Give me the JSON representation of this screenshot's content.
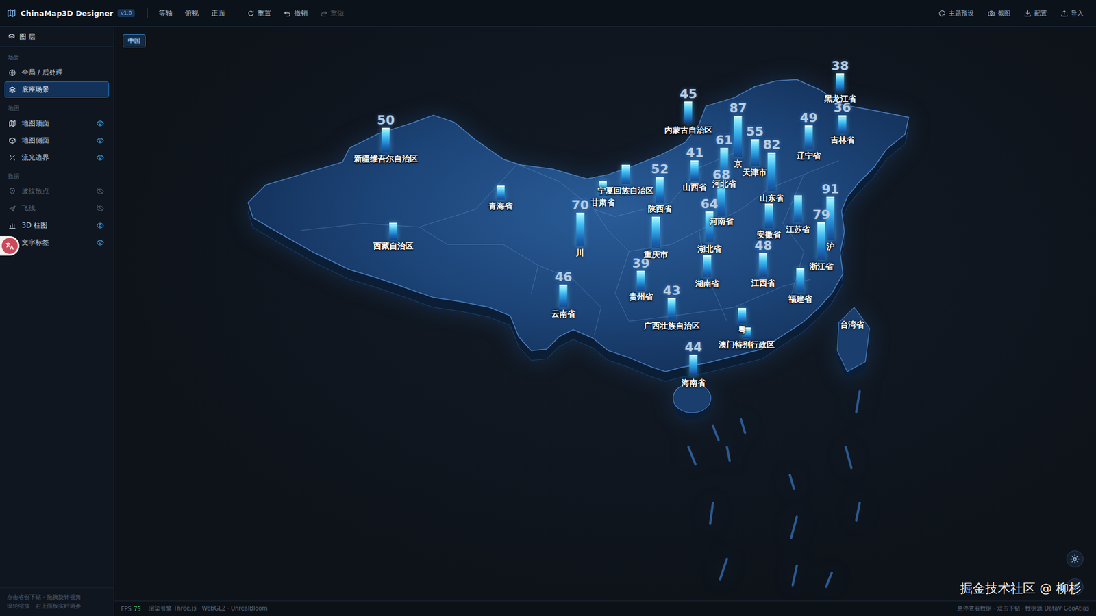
{
  "app": {
    "title": "ChinaMap3D Designer",
    "version": "v1.0"
  },
  "toolbar": {
    "views": [
      {
        "label": "等轴"
      },
      {
        "label": "俯视"
      },
      {
        "label": "正面"
      }
    ],
    "actions": [
      {
        "label": "重置",
        "kind": "reset",
        "disabled": false
      },
      {
        "label": "撤销",
        "kind": "undo",
        "disabled": false
      },
      {
        "label": "重做",
        "kind": "redo",
        "disabled": true
      }
    ],
    "tools": [
      {
        "label": "主题预设",
        "kind": "theme"
      },
      {
        "label": "截图",
        "kind": "screenshot"
      },
      {
        "label": "配置",
        "kind": "export"
      },
      {
        "label": "导入",
        "kind": "import"
      }
    ]
  },
  "sidebar": {
    "title": "图 层",
    "sections": [
      {
        "label": "场景",
        "items": [
          {
            "label": "全局 / 后处理",
            "kind": "scene",
            "selected": false
          },
          {
            "label": "底座场景",
            "kind": "scene",
            "selected": true
          }
        ]
      },
      {
        "label": "地图",
        "items": [
          {
            "label": "地图顶面",
            "kind": "layer",
            "selected": false,
            "visible": true
          },
          {
            "label": "地图侧面",
            "kind": "layer",
            "selected": false,
            "visible": true
          },
          {
            "label": "流光边界",
            "kind": "layer",
            "selected": false,
            "visible": true
          }
        ]
      },
      {
        "label": "数据",
        "items": [
          {
            "label": "波纹散点",
            "kind": "layer",
            "selected": false,
            "visible": false
          },
          {
            "label": "飞线",
            "kind": "layer",
            "selected": false,
            "visible": false
          },
          {
            "label": "3D 柱图",
            "kind": "layer",
            "selected": false,
            "visible": true
          },
          {
            "label": "文字标签",
            "kind": "layer",
            "selected": false,
            "visible": true
          }
        ]
      }
    ],
    "hint": [
      "点击省份下钻 · 拖拽旋转视角",
      "滚轮缩放 · 右上面板实时调参"
    ]
  },
  "breadcrumb": [
    {
      "label": "中国",
      "selected": true
    }
  ],
  "map": {
    "provinces": [
      {
        "name": "新疆维吾尔自治区",
        "value": "50",
        "level": 0.5
      },
      {
        "name": "西藏自治区",
        "value": null,
        "level": 0.33
      },
      {
        "name": "青海省",
        "value": null,
        "level": 0.27
      },
      {
        "name": "甘肃省",
        "value": null,
        "level": 0.3
      },
      {
        "name": "宁夏回族自治区",
        "value": null,
        "level": 0.39
      },
      {
        "name": "内蒙古自治区",
        "value": "45",
        "level": 0.45
      },
      {
        "name": "陕西省",
        "value": "52",
        "level": 0.52
      },
      {
        "name": "山西省",
        "value": "41",
        "level": 0.41
      },
      {
        "name": "河北省",
        "value": "61",
        "level": 0.61
      },
      {
        "name": "京",
        "value": "87",
        "level": 0.87
      },
      {
        "name": "天津市",
        "value": "55",
        "level": 0.55
      },
      {
        "name": "黑龙江省",
        "value": "38",
        "level": 0.38
      },
      {
        "name": "吉林省",
        "value": "36",
        "level": 0.36
      },
      {
        "name": "辽宁省",
        "value": "49",
        "level": 0.49
      },
      {
        "name": "山东省",
        "value": "82",
        "level": 0.82
      },
      {
        "name": "河南省",
        "value": "68",
        "level": 0.68
      },
      {
        "name": "江苏省",
        "value": null,
        "level": 0.57
      },
      {
        "name": "安徽省",
        "value": null,
        "level": 0.5
      },
      {
        "name": "湖北省",
        "value": "64",
        "level": 0.64
      },
      {
        "name": "川",
        "value": "70",
        "level": 0.7
      },
      {
        "name": "重庆市",
        "value": null,
        "level": 0.65
      },
      {
        "name": "沪",
        "value": "91",
        "level": 0.91
      },
      {
        "name": "浙江省",
        "value": "79",
        "level": 0.79
      },
      {
        "name": "湖南省",
        "value": null,
        "level": 0.45
      },
      {
        "name": "江西省",
        "value": "48",
        "level": 0.48
      },
      {
        "name": "福建省",
        "value": null,
        "level": 0.5
      },
      {
        "name": "贵州省",
        "value": "39",
        "level": 0.39
      },
      {
        "name": "云南省",
        "value": "46",
        "level": 0.46
      },
      {
        "name": "广西壮族自治区",
        "value": "43",
        "level": 0.43
      },
      {
        "name": "粤",
        "value": null,
        "level": 0.3
      },
      {
        "name": "澳门特别行政区",
        "value": null,
        "level": 0.2
      },
      {
        "name": "海南省",
        "value": "44",
        "level": 0.44
      },
      {
        "name": "台湾省",
        "value": null,
        "level": 0
      }
    ]
  },
  "status_bar": {
    "fps_label": "FPS",
    "fps": "75",
    "engine": "渲染引擎 Three.js · WebGL2 · UnrealBloom",
    "hint": "悬停查看数据 · 双击下钻 · 数据源 DataV GeoAtlas"
  },
  "watermark": "掘金技术社区 @ 柳杉"
}
